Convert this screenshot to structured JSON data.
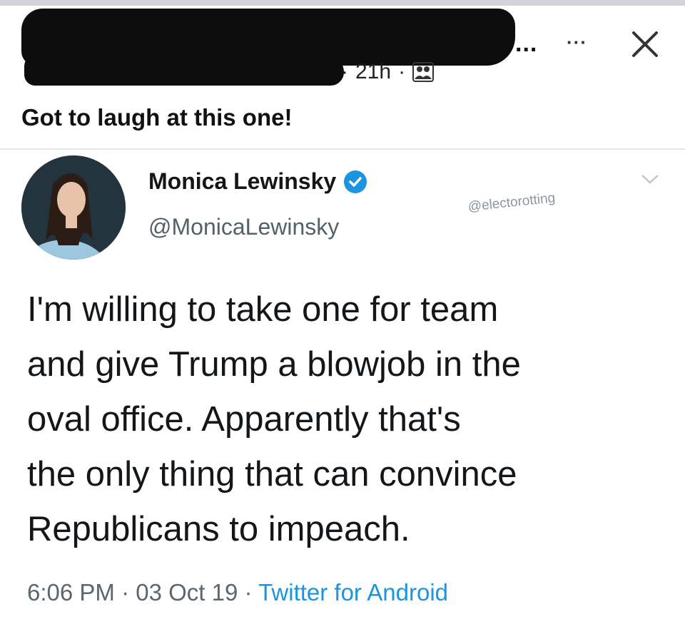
{
  "post": {
    "name_tail": "...",
    "time": "21h",
    "separator": "·",
    "audience_icon": "friends-audience-icon",
    "caption": "Got to laugh at this one!"
  },
  "header_actions": {
    "more_icon": "more-dots-icon",
    "more_label": "···",
    "close_icon": "close-icon"
  },
  "tweet": {
    "display_name": "Monica Lewinsky",
    "handle": "@MonicaLewinsky",
    "verified": true,
    "watermark": "@electorotting",
    "text_lines": [
      "I'm willing to take one for team",
      "and give Trump a blowjob in the",
      "oval office. Apparently that's",
      "the only thing that can convince",
      "Republicans to impeach."
    ],
    "time": "6:06 PM",
    "date": "03 Oct 19",
    "source": "Twitter for Android",
    "dot": " · "
  },
  "colors": {
    "twitter_blue": "#1b95e0",
    "text_dark": "#14171a",
    "text_muted": "#5b6670"
  }
}
